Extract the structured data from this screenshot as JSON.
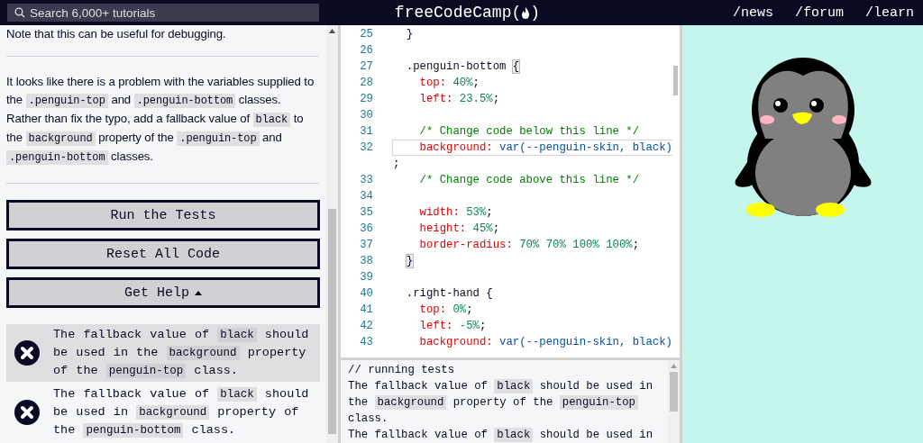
{
  "navbar": {
    "search": {
      "placeholder": "Search 6,000+ tutorials"
    },
    "logo": {
      "text": "freeCodeCamp",
      "open": "(",
      "close": ")"
    },
    "links": [
      "/news",
      "/forum",
      "/learn"
    ]
  },
  "instructions": {
    "paragraphs": [
      [
        {
          "kind": "text",
          "text": "Note that this can be useful for debugging."
        }
      ],
      [
        {
          "kind": "text",
          "text": "It looks like there is a problem with the variables supplied to the "
        },
        {
          "kind": "code",
          "text": ".penguin-top"
        },
        {
          "kind": "text",
          "text": " and "
        },
        {
          "kind": "code",
          "text": ".penguin-bottom"
        },
        {
          "kind": "text",
          "text": " classes. Rather than fix the typo, add a fallback value of "
        },
        {
          "kind": "code",
          "text": "black"
        },
        {
          "kind": "text",
          "text": " to the "
        },
        {
          "kind": "code",
          "text": "background"
        },
        {
          "kind": "text",
          "text": " property of the "
        },
        {
          "kind": "code",
          "text": ".penguin-top"
        },
        {
          "kind": "text",
          "text": " and "
        },
        {
          "kind": "code",
          "text": ".penguin-bottom"
        },
        {
          "kind": "text",
          "text": " classes."
        }
      ]
    ]
  },
  "buttons": [
    {
      "label": "Run the Tests",
      "caret": false
    },
    {
      "label": "Reset All Code",
      "caret": false
    },
    {
      "label": "Get Help",
      "caret": true
    }
  ],
  "tests": [
    {
      "passed": false,
      "selected": true,
      "segments": [
        {
          "kind": "text",
          "text": "The fallback value of "
        },
        {
          "kind": "code",
          "text": "black"
        },
        {
          "kind": "text",
          "text": " should be used in the "
        },
        {
          "kind": "code",
          "text": "background"
        },
        {
          "kind": "text",
          "text": " property of the "
        },
        {
          "kind": "code",
          "text": "penguin-top"
        },
        {
          "kind": "text",
          "text": " class."
        }
      ]
    },
    {
      "passed": false,
      "selected": false,
      "segments": [
        {
          "kind": "text",
          "text": "The fallback value of "
        },
        {
          "kind": "code",
          "text": "black"
        },
        {
          "kind": "text",
          "text": " should be used in "
        },
        {
          "kind": "code",
          "text": "background"
        },
        {
          "kind": "text",
          "text": " property of the "
        },
        {
          "kind": "code",
          "text": "penguin-bottom"
        },
        {
          "kind": "text",
          "text": " class."
        }
      ]
    }
  ],
  "editor": {
    "lines": [
      {
        "number": "25",
        "active": false,
        "tokens": [
          {
            "kind": "plain",
            "text": "  }"
          }
        ]
      },
      {
        "number": "26",
        "active": false
      },
      {
        "number": "27",
        "active": false,
        "tokens": [
          {
            "kind": "plain",
            "text": "  .penguin-bottom "
          },
          {
            "kind": "match",
            "text": "{"
          }
        ]
      },
      {
        "number": "28",
        "active": false,
        "tokens": [
          {
            "kind": "property",
            "text": "    top: "
          },
          {
            "kind": "number",
            "text": "40%"
          },
          {
            "kind": "plain",
            "text": ";"
          }
        ]
      },
      {
        "number": "29",
        "active": false,
        "tokens": [
          {
            "kind": "property",
            "text": "    left: "
          },
          {
            "kind": "number",
            "text": "23.5%"
          },
          {
            "kind": "plain",
            "text": ";"
          }
        ]
      },
      {
        "number": "30",
        "active": false
      },
      {
        "number": "31",
        "active": false,
        "tokens": [
          {
            "kind": "comment",
            "text": "    /* Change code below this line */"
          }
        ]
      },
      {
        "number": "32",
        "active": true,
        "tokens": [
          {
            "kind": "property",
            "text": "    background: "
          },
          {
            "kind": "value",
            "text": "var(--penguin-skin, black)"
          }
        ]
      },
      {
        "active": false,
        "tokens": [
          {
            "kind": "plain",
            "text": ";"
          }
        ]
      },
      {
        "number": "33",
        "active": false,
        "tokens": [
          {
            "kind": "comment",
            "text": "    /* Change code above this line */"
          }
        ]
      },
      {
        "number": "34",
        "active": false
      },
      {
        "number": "35",
        "active": false,
        "tokens": [
          {
            "kind": "property",
            "text": "    width: "
          },
          {
            "kind": "number",
            "text": "53%"
          },
          {
            "kind": "plain",
            "text": ";"
          }
        ]
      },
      {
        "number": "36",
        "active": false,
        "tokens": [
          {
            "kind": "property",
            "text": "    height: "
          },
          {
            "kind": "number",
            "text": "45%"
          },
          {
            "kind": "plain",
            "text": ";"
          }
        ]
      },
      {
        "number": "37",
        "active": false,
        "tokens": [
          {
            "kind": "property",
            "text": "    border-radius: "
          },
          {
            "kind": "number",
            "text": "70% 70% 100% 100%"
          },
          {
            "kind": "plain",
            "text": ";"
          }
        ]
      },
      {
        "number": "38",
        "active": false,
        "tokens": [
          {
            "kind": "match-indented",
            "text": "}"
          }
        ]
      },
      {
        "number": "39",
        "active": false
      },
      {
        "number": "40",
        "active": false,
        "tokens": [
          {
            "kind": "plain",
            "text": "  .right-hand {"
          }
        ]
      },
      {
        "number": "41",
        "active": false,
        "tokens": [
          {
            "kind": "property",
            "text": "    top: "
          },
          {
            "kind": "number",
            "text": "0%"
          },
          {
            "kind": "plain",
            "text": ";"
          }
        ]
      },
      {
        "number": "42",
        "active": false,
        "tokens": [
          {
            "kind": "property",
            "text": "    left: "
          },
          {
            "kind": "number",
            "text": "-5%"
          },
          {
            "kind": "plain",
            "text": ";"
          }
        ]
      },
      {
        "number": "43",
        "active": false,
        "tokens": [
          {
            "kind": "property",
            "text": "    background: "
          },
          {
            "kind": "value",
            "text": "var(--penguin-skin, black)"
          }
        ]
      }
    ]
  },
  "console": {
    "lines": [
      [
        {
          "kind": "text",
          "text": "// running tests"
        }
      ],
      [
        {
          "kind": "text",
          "text": "The fallback value of "
        },
        {
          "kind": "code",
          "text": "black"
        },
        {
          "kind": "text",
          "text": " should be used in the "
        },
        {
          "kind": "code",
          "text": "background"
        },
        {
          "kind": "text",
          "text": " property of the "
        },
        {
          "kind": "code",
          "text": "penguin-top"
        },
        {
          "kind": "text",
          "text": " class."
        }
      ],
      [
        {
          "kind": "text",
          "text": "The fallback value of "
        },
        {
          "kind": "code",
          "text": "black"
        },
        {
          "kind": "text",
          "text": " should be used in"
        }
      ]
    ]
  }
}
